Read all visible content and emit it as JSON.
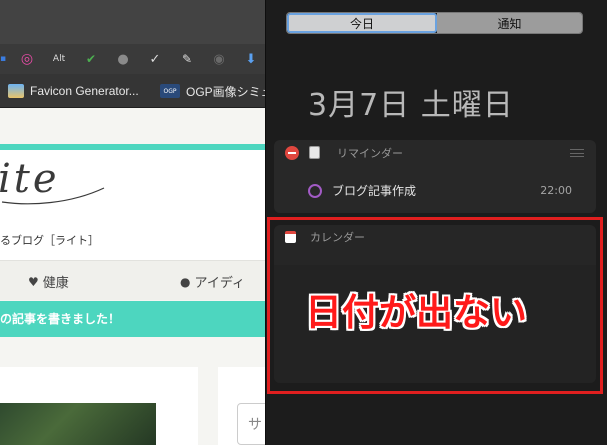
{
  "browser": {
    "toolbar_icons": [
      {
        "name": "extension-icon",
        "glyph": "▪",
        "color": "#3b7de0"
      },
      {
        "name": "color-wheel-icon",
        "glyph": "◎",
        "color": "#e94ca7"
      },
      {
        "name": "alt-text-icon",
        "glyph": "Alt",
        "color": "#eeeeee"
      },
      {
        "name": "checkmark-icon",
        "glyph": "✔",
        "color": "#4caf50"
      },
      {
        "name": "info-icon",
        "glyph": "●",
        "color": "#8a8a8a"
      },
      {
        "name": "check-box-icon",
        "glyph": "✓",
        "color": "#e8e8e8"
      },
      {
        "name": "eyedropper-icon",
        "glyph": "✎",
        "color": "#cfcfcf"
      },
      {
        "name": "wordpress-icon",
        "glyph": "◉",
        "color": "#6a6a6a"
      },
      {
        "name": "download-icon",
        "glyph": "⬇",
        "color": "#5aa0f0"
      }
    ],
    "bookmarks": [
      {
        "label": "Favicon Generator...",
        "icon": "favicon-icon"
      },
      {
        "label": "OGP画像シミュ",
        "icon": "ogp-icon",
        "badge": "OGP"
      }
    ],
    "page": {
      "logo_script": "ite",
      "logo_tagline": "るブログ［ライト］",
      "nav_items": [
        {
          "label": "健康",
          "icon": "heart-pulse-icon"
        },
        {
          "label": "アイディ",
          "icon": "lightbulb-icon"
        }
      ],
      "notice": "の記事を書きました！",
      "search_glyph": "サ"
    }
  },
  "notification_center": {
    "tabs": [
      {
        "label": "今日",
        "selected": true
      },
      {
        "label": "通知",
        "selected": false
      }
    ],
    "date": "3月7日 土曜日",
    "reminders": {
      "title": "リマインダー",
      "items": [
        {
          "text": "ブログ記事作成",
          "time": "22:00"
        }
      ]
    },
    "calendar": {
      "title": "カレンダー"
    }
  },
  "annotation": {
    "text": "日付が出ない",
    "color": "#ff1a1a"
  }
}
